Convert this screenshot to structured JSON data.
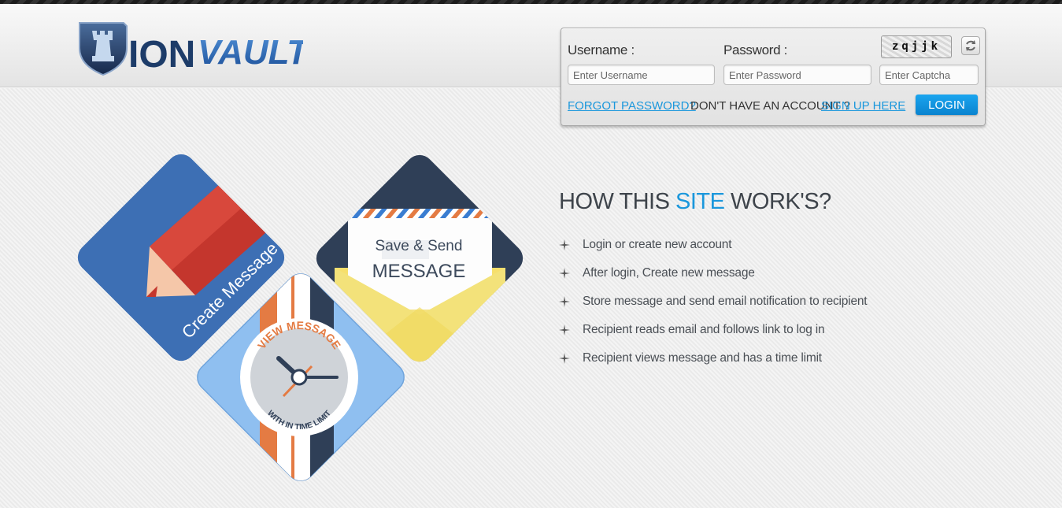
{
  "brand": {
    "name": "IONVAULT",
    "name_part1": "ION",
    "name_part2": "VAULT"
  },
  "login": {
    "username_label": "Username :",
    "username_placeholder": "Enter Username",
    "password_label": "Password :",
    "password_placeholder": "Enter Password",
    "captcha_text": "zqjjk",
    "captcha_placeholder": "Enter Captcha",
    "forgot_password": "FORGOT PASSWORD?",
    "no_account": "DON'T HAVE AN ACCOUNT ?",
    "sign_up": "SIGN UP HERE",
    "login_button": "LOGIN"
  },
  "tiles": {
    "create": "Create Message",
    "save_line1": "Save & Send",
    "save_line2": "MESSAGE",
    "view_top": "VIEW MESSAGE",
    "view_bottom": "WITH IN TIME LIMIT"
  },
  "how": {
    "title_part1": "HOW THIS ",
    "title_accent": "SITE",
    "title_part2": " WORK'S?",
    "steps": [
      "Login or create new account",
      "After login, Create new message",
      "Store message and send email notification to recipient",
      "Recipient reads email and follows link to log in",
      "Recipient views message and has a time limit"
    ]
  },
  "colors": {
    "accent": "#1a97dc",
    "tile_blue": "#3d6fb4",
    "tile_navy": "#2f3f57",
    "tile_light_blue": "#8fbff0",
    "orange": "#e47b43"
  },
  "icons": [
    "shield-rook-icon",
    "refresh-icon",
    "pencil-icon",
    "envelope-icon",
    "watch-icon",
    "sparkle-bullet-icon"
  ]
}
